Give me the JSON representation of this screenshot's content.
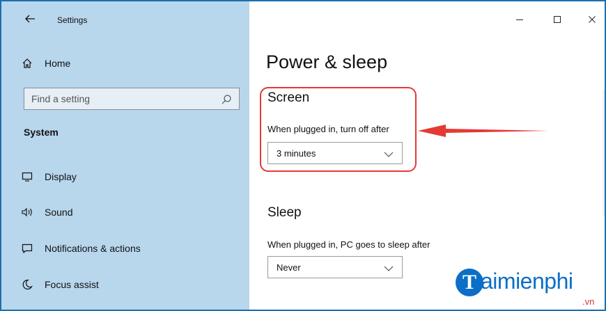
{
  "window": {
    "app_title": "Settings",
    "controls": {
      "minimize": "–",
      "maximize": "☐",
      "close": "✕"
    }
  },
  "sidebar": {
    "home_label": "Home",
    "search_placeholder": "Find a setting",
    "section_label": "System",
    "items": [
      {
        "label": "Display",
        "icon": "display-icon"
      },
      {
        "label": "Sound",
        "icon": "sound-icon"
      },
      {
        "label": "Notifications & actions",
        "icon": "notifications-icon"
      },
      {
        "label": "Focus assist",
        "icon": "moon-icon"
      }
    ]
  },
  "main": {
    "page_title": "Power & sleep",
    "screen": {
      "title": "Screen",
      "label": "When plugged in, turn off after",
      "value": "3 minutes"
    },
    "sleep": {
      "title": "Sleep",
      "label": "When plugged in, PC goes to sleep after",
      "value": "Never"
    }
  },
  "watermark": {
    "initial": "T",
    "text": "aimienphi",
    "suffix": ".vn"
  },
  "colors": {
    "sidebar_bg": "#b8d6ec",
    "highlight": "#e53935",
    "arrow": "#e53935",
    "logo_blue": "#0b6fc7"
  }
}
